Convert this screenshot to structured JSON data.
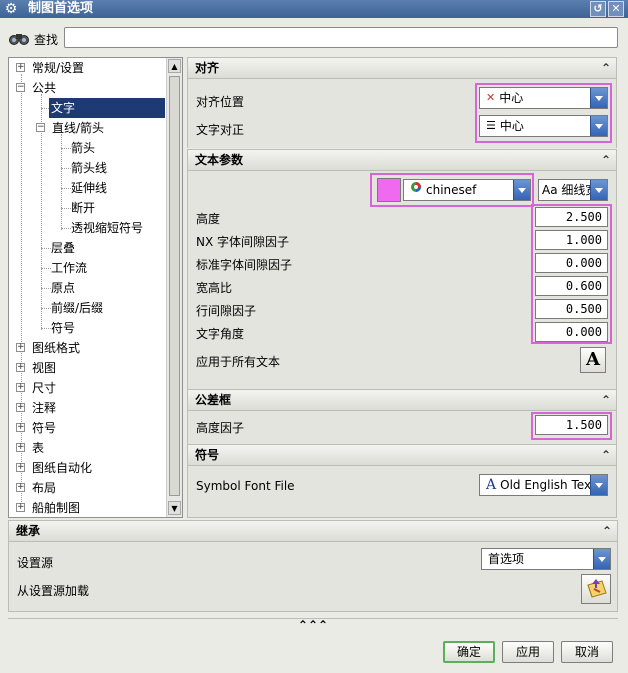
{
  "window": {
    "title": "制图首选项"
  },
  "search": {
    "label": "查找",
    "value": ""
  },
  "tree": {
    "items": [
      {
        "label": "常规/设置",
        "expander": "+"
      },
      {
        "label": "公共",
        "expander": "−"
      },
      {
        "label": "文字"
      },
      {
        "label": "直线/箭头",
        "expander": "−"
      },
      {
        "label": "箭头"
      },
      {
        "label": "箭头线"
      },
      {
        "label": "延伸线"
      },
      {
        "label": "断开"
      },
      {
        "label": "透视缩短符号"
      },
      {
        "label": "层叠"
      },
      {
        "label": "工作流"
      },
      {
        "label": "原点"
      },
      {
        "label": "前缀/后缀"
      },
      {
        "label": "符号"
      },
      {
        "label": "图纸格式",
        "expander": "+"
      },
      {
        "label": "视图",
        "expander": "+"
      },
      {
        "label": "尺寸",
        "expander": "+"
      },
      {
        "label": "注释",
        "expander": "+"
      },
      {
        "label": "符号",
        "expander": "+"
      },
      {
        "label": "表",
        "expander": "+"
      },
      {
        "label": "图纸自动化",
        "expander": "+"
      },
      {
        "label": "布局",
        "expander": "+"
      },
      {
        "label": "船舶制图",
        "expander": "+"
      }
    ]
  },
  "align": {
    "header": "对齐",
    "position_label": "对齐位置",
    "position_value": "中心",
    "justify_label": "文字对正",
    "justify_value": "中心"
  },
  "text_params": {
    "header": "文本参数",
    "color": "#f06af0",
    "font_value": "chinesef",
    "style_value": "Aa 细线宽",
    "fields": [
      {
        "label": "高度",
        "value": "2.500"
      },
      {
        "label": "NX 字体间隙因子",
        "value": "1.000"
      },
      {
        "label": "标准字体间隙因子",
        "value": "0.000"
      },
      {
        "label": "宽高比",
        "value": "0.600"
      },
      {
        "label": "行间隙因子",
        "value": "0.500"
      },
      {
        "label": "文字角度",
        "value": "0.000"
      }
    ],
    "apply_all_label": "应用于所有文本"
  },
  "tolerance": {
    "header": "公差框",
    "height_factor_label": "高度因子",
    "height_factor_value": "1.500"
  },
  "symbol": {
    "header": "符号",
    "font_file_label": "Symbol Font File",
    "font_file_value": "Old English Text"
  },
  "inherit": {
    "header": "继承",
    "source_label": "设置源",
    "source_value": "首选项",
    "load_label": "从设置源加载"
  },
  "footer": {
    "collapse_glyph": "⌃⌃⌃",
    "ok": "确定",
    "apply": "应用",
    "cancel": "取消"
  }
}
